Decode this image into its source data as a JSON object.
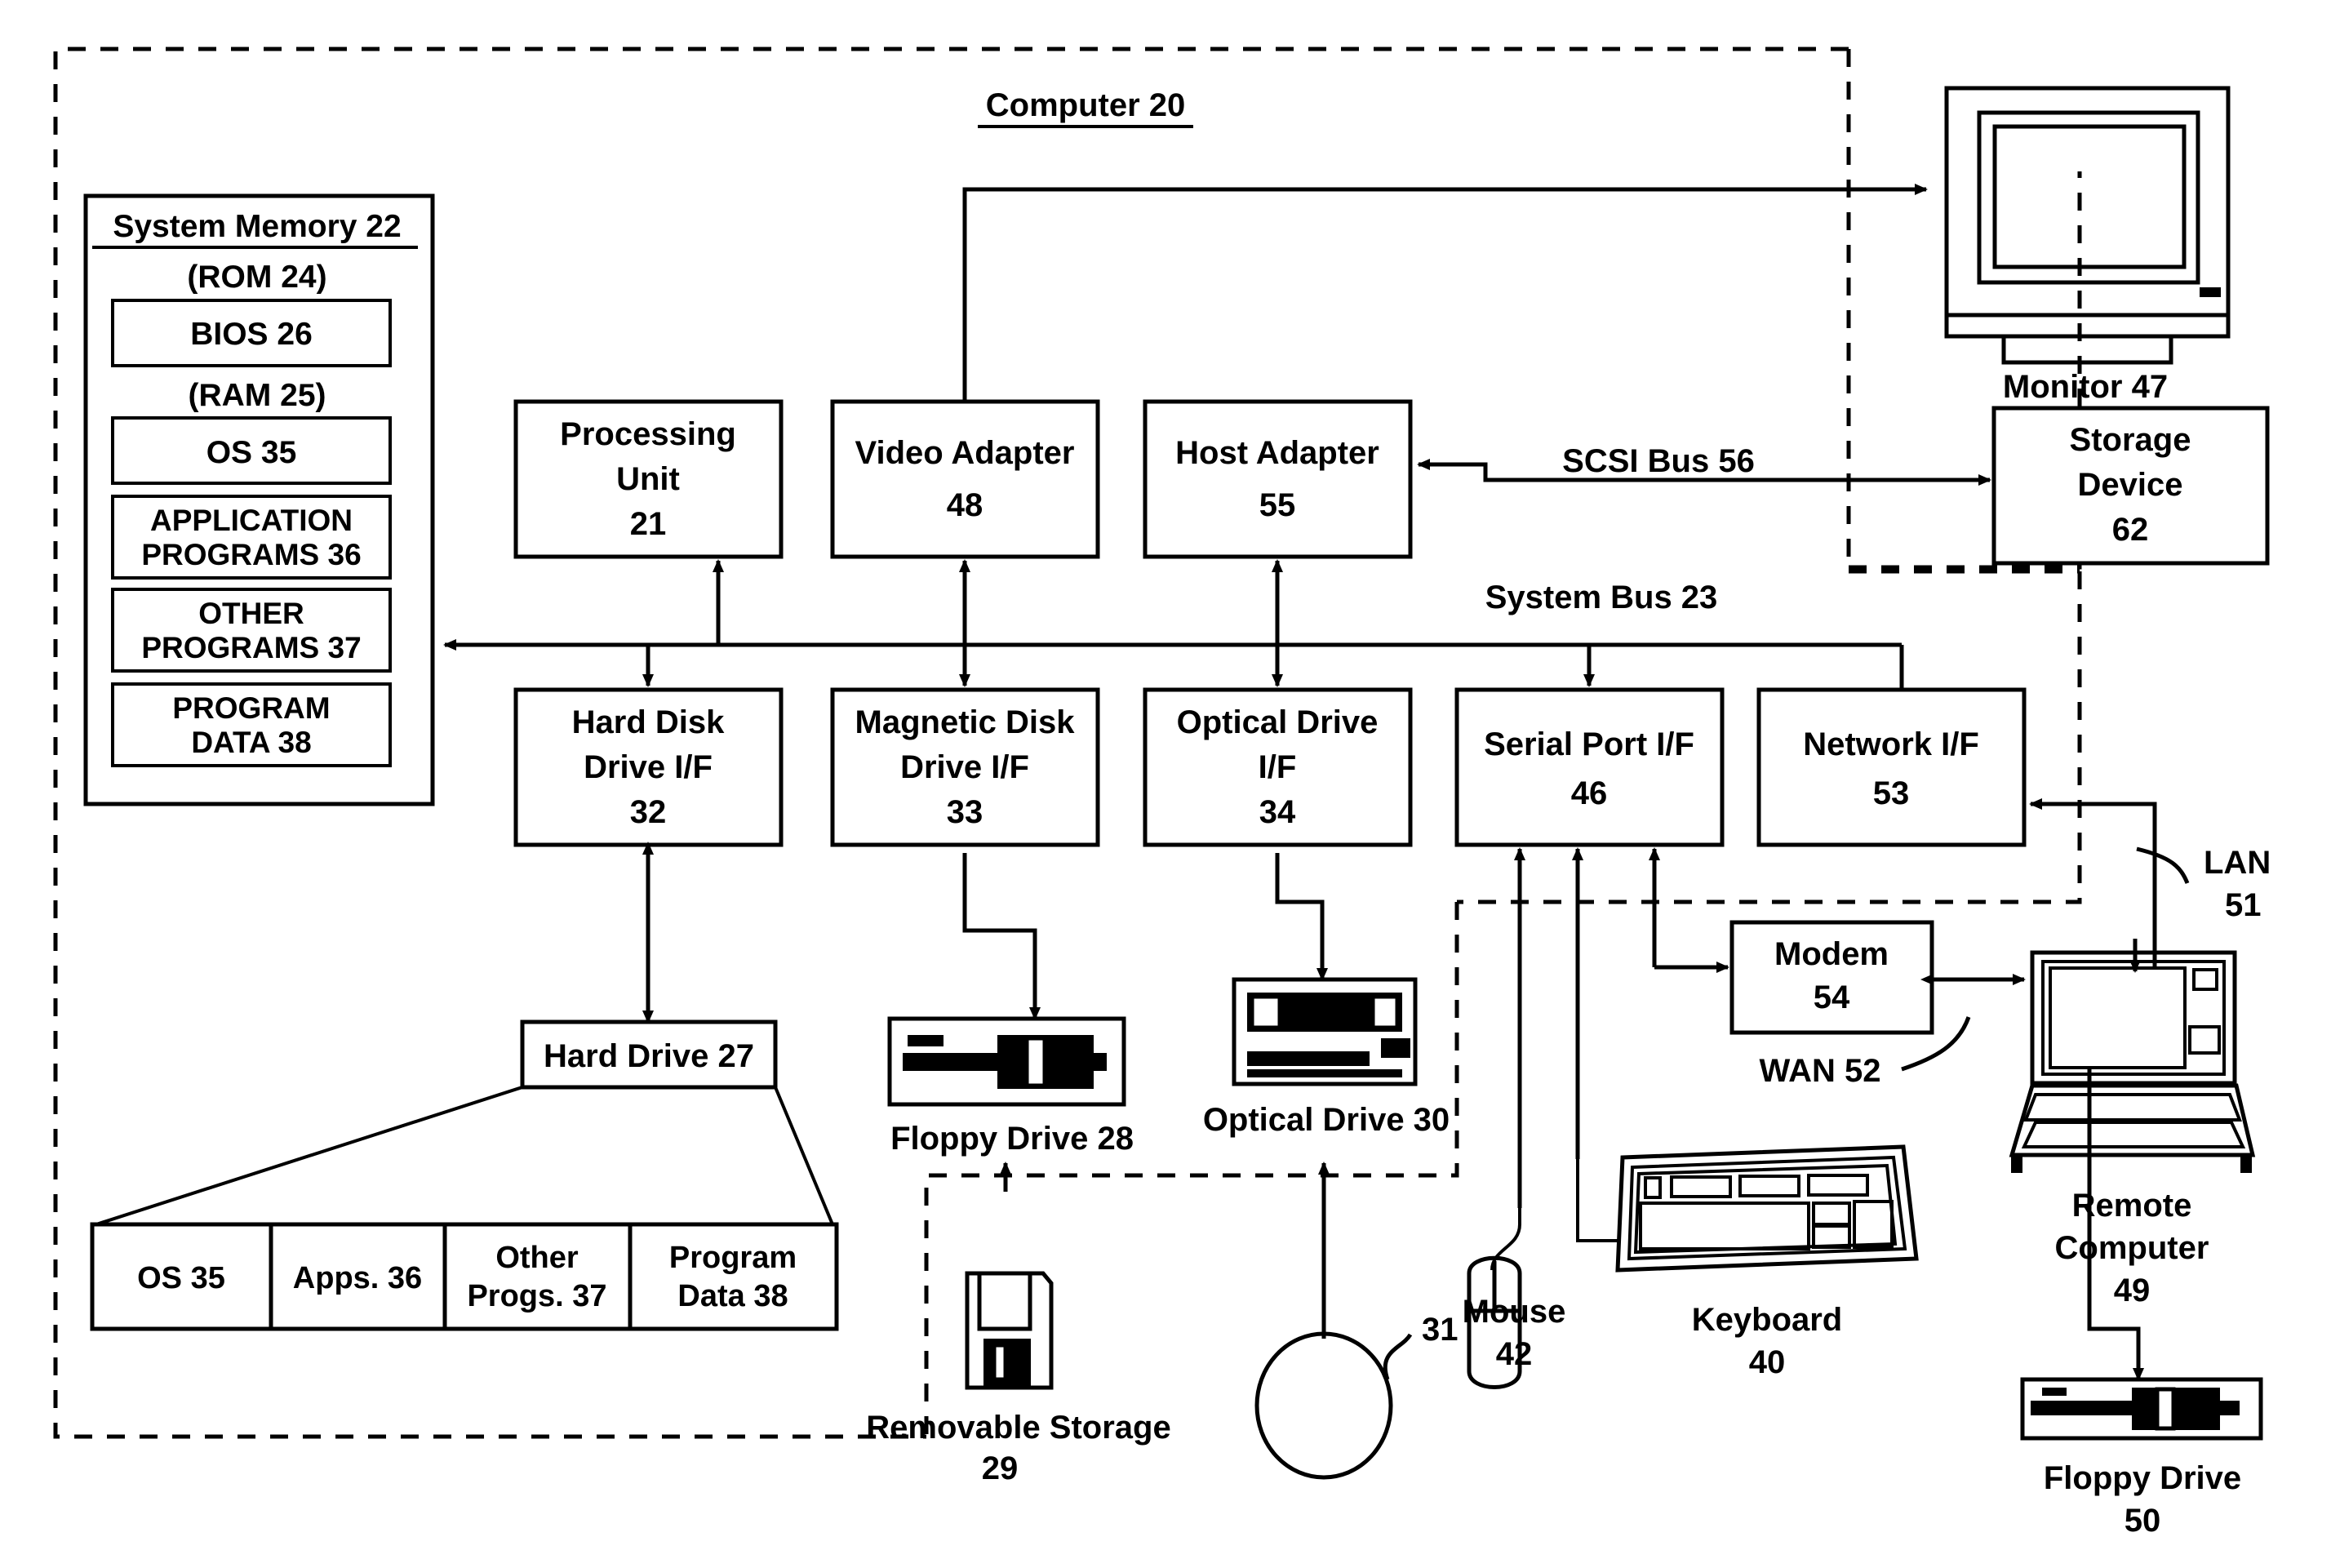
{
  "figure": {
    "title": "Computer 20",
    "system_bus_label": "System Bus 23",
    "scsi_bus_label": "SCSI Bus 56",
    "lan_label_line1": "LAN",
    "lan_label_line2": "51",
    "wan_label": "WAN 52",
    "disc_callout": "31"
  },
  "system_memory": {
    "heading": "System Memory 22",
    "rom_header": "(ROM 24)",
    "rom_items": [
      {
        "label": "BIOS 26"
      }
    ],
    "ram_header": "(RAM 25)",
    "ram_items": [
      {
        "line1": "OS 35",
        "line2": ""
      },
      {
        "line1": "APPLICATION",
        "line2": "PROGRAMS 36"
      },
      {
        "line1": "OTHER",
        "line2": "PROGRAMS 37"
      },
      {
        "line1": "PROGRAM",
        "line2": "DATA 38"
      }
    ]
  },
  "core_boxes": [
    {
      "line1": "Processing",
      "line2": "Unit",
      "line3": "21"
    },
    {
      "line1": "Video Adapter",
      "line2": "48",
      "line3": ""
    },
    {
      "line1": "Host Adapter",
      "line2": "55",
      "line3": ""
    }
  ],
  "interface_boxes": [
    {
      "line1": "Hard Disk",
      "line2": "Drive I/F",
      "line3": "32"
    },
    {
      "line1": "Magnetic Disk",
      "line2": "Drive I/F",
      "line3": "33"
    },
    {
      "line1": "Optical Drive",
      "line2": "I/F",
      "line3": "34"
    },
    {
      "line1": "Serial Port I/F",
      "line2": "46",
      "line3": ""
    },
    {
      "line1": "Network I/F",
      "line2": "53",
      "line3": ""
    }
  ],
  "peripheral_boxes": [
    {
      "line1": "Storage",
      "line2": "Device",
      "line3": "62"
    },
    {
      "line1": "Modem",
      "line2": "54",
      "line3": ""
    }
  ],
  "hard_drive": {
    "label": "Hard Drive 27",
    "partitions": [
      {
        "line1": "OS 35",
        "line2": ""
      },
      {
        "line1": "Apps. 36",
        "line2": ""
      },
      {
        "line1": "Other",
        "line2": "Progs. 37"
      },
      {
        "line1": "Program",
        "line2": "Data   38"
      }
    ]
  },
  "device_labels": {
    "monitor": "Monitor 47",
    "floppy_drive_28": "Floppy Drive 28",
    "optical_drive_30": "Optical Drive 30",
    "removable_storage_line1": "Removable Storage",
    "removable_storage_line2": "29",
    "mouse_line1": "Mouse",
    "mouse_line2": "42",
    "keyboard_line1": "Keyboard",
    "keyboard_line2": "40",
    "remote_computer_line1": "Remote",
    "remote_computer_line2": "Computer",
    "remote_computer_line3": "49",
    "floppy_drive_50_line1": "Floppy Drive",
    "floppy_drive_50_line2": "50"
  },
  "colors": {
    "ink": "#000000",
    "paper": "#ffffff"
  }
}
